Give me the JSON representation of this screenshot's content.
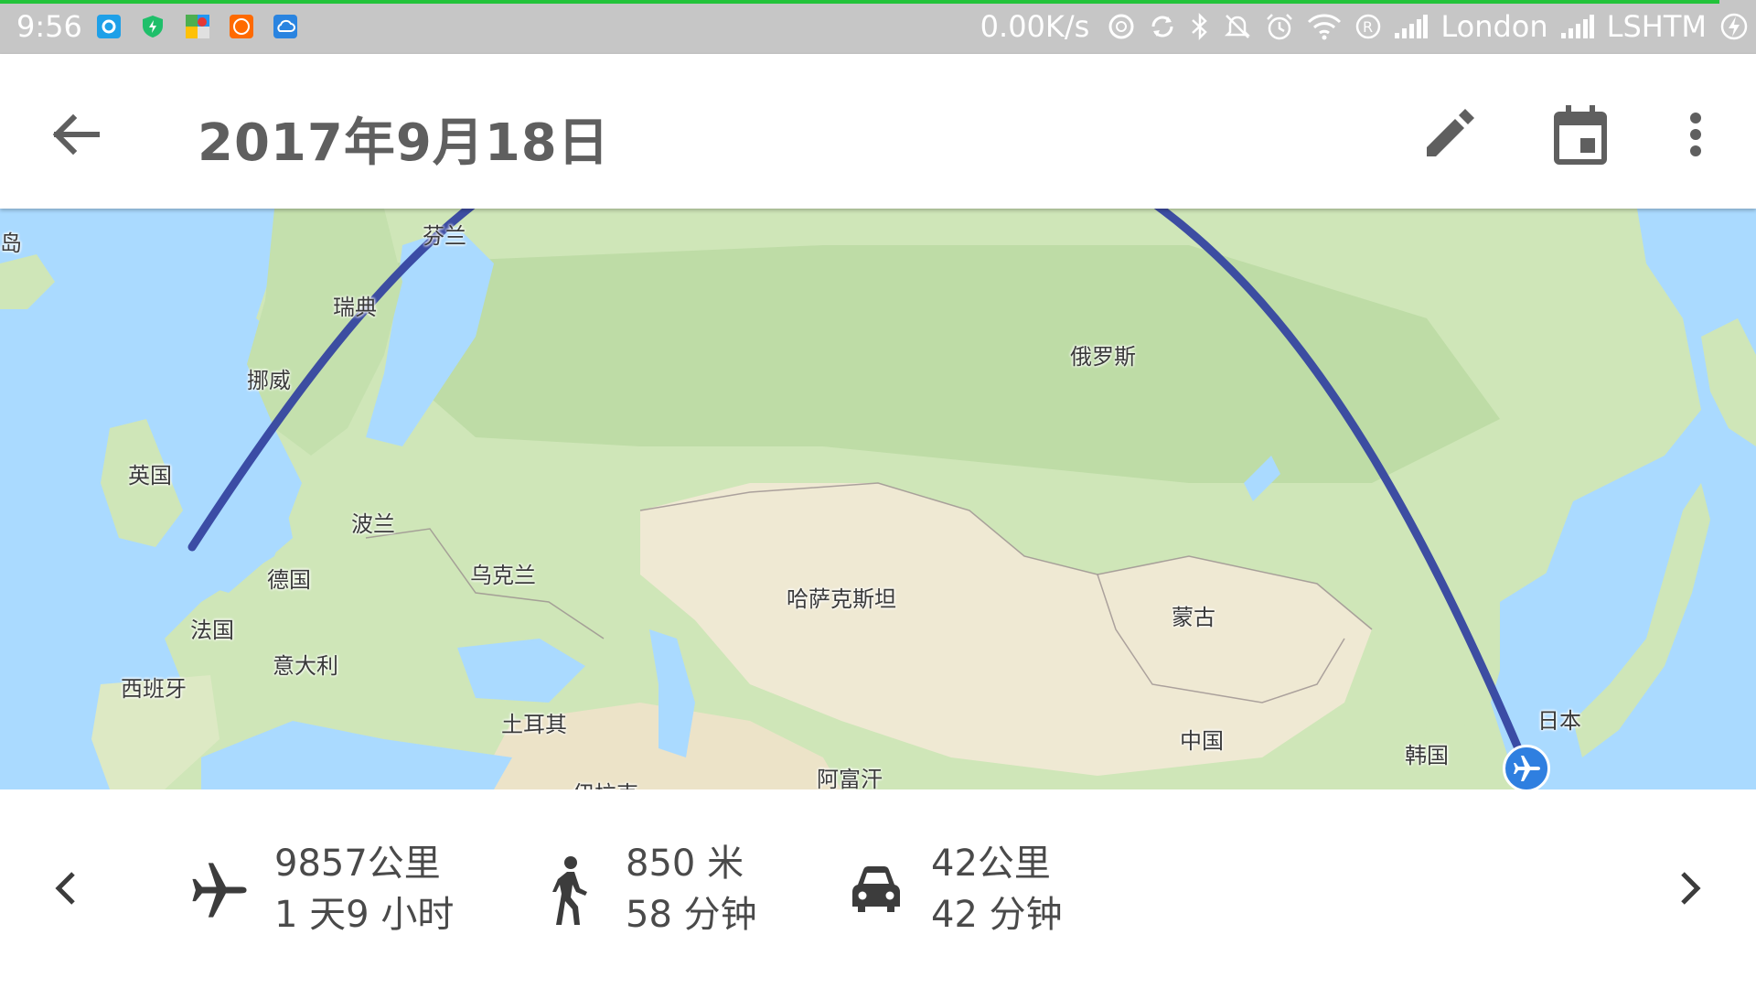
{
  "status_bar": {
    "time": "9:56",
    "net_speed": "0.00K/s",
    "carrier_1": "London",
    "carrier_2": "LSHTM",
    "accent_color": "#22c33a",
    "icons": [
      "bike-app-icon",
      "shield-icon",
      "maps-icon",
      "mi-icon",
      "cloud-icon",
      "nfc-icon",
      "sync-icon",
      "bluetooth-icon",
      "mute-icon",
      "alarm-icon",
      "wifi-icon",
      "roaming-icon",
      "signal-icon",
      "signal-icon",
      "charging-icon"
    ]
  },
  "app_bar": {
    "title": "2017年9月18日",
    "icons": [
      "back-arrow-icon",
      "edit-pencil-icon",
      "calendar-icon",
      "more-vert-icon"
    ]
  },
  "map": {
    "labels": {
      "iceland": "冰岛",
      "finland": "芬兰",
      "sweden": "瑞典",
      "norway": "挪威",
      "uk": "英国",
      "poland": "波兰",
      "germany": "德国",
      "ukraine": "乌克兰",
      "france": "法国",
      "italy": "意大利",
      "spain": "西班牙",
      "turkey": "土耳其",
      "iran": "伊拉克",
      "afghanistan": "阿富汗",
      "kazakhstan": "哈萨克斯坦",
      "russia": "俄罗斯",
      "mongolia": "蒙古",
      "china": "中国",
      "korea": "韩国",
      "japan": "日本"
    },
    "route_color": "#3545a0",
    "marker_icon": "airplane-icon"
  },
  "summary": {
    "flight": {
      "distance": "9857公里",
      "duration": "1 天9 小时",
      "icon": "airplane-icon"
    },
    "walking": {
      "distance": "850 米",
      "duration": "58 分钟",
      "icon": "walking-icon"
    },
    "driving": {
      "distance": "42公里",
      "duration": "42 分钟",
      "icon": "car-icon"
    },
    "nav_icons": [
      "chevron-left-icon",
      "chevron-right-icon"
    ]
  }
}
